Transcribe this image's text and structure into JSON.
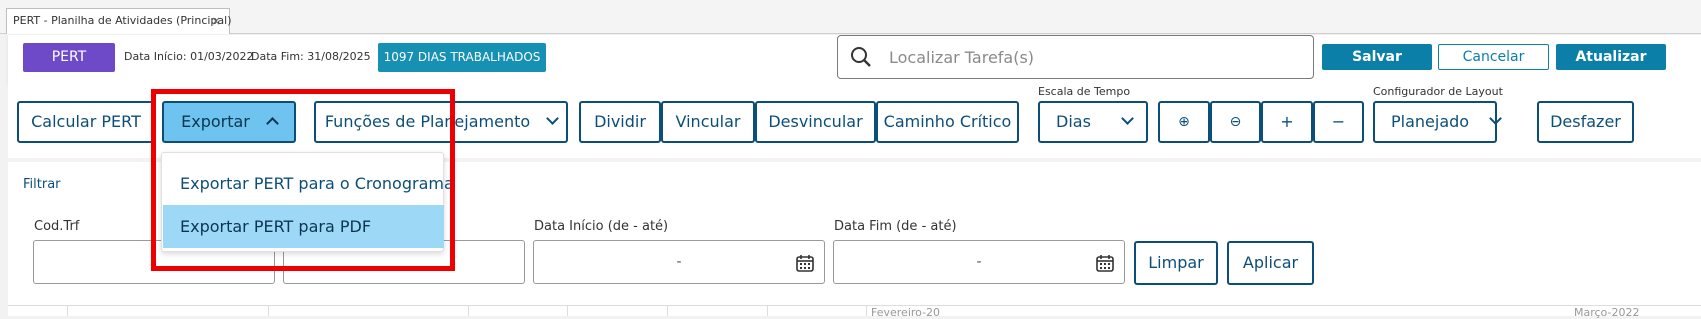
{
  "tab": {
    "title": "PERT - Planilha de Atividades (Principal)",
    "close": "×"
  },
  "header": {
    "badge": "PERT",
    "data_inicio_label": "Data Início: 01/03/2022",
    "data_fim_label": "Data Fim: 31/08/2025",
    "dias_badge": "1097 DIAS TRABALHADOS",
    "search_placeholder": "Localizar Tarefa(s)",
    "save": "Salvar",
    "cancel": "Cancelar",
    "update": "Atualizar"
  },
  "toolbar": {
    "calcular": "Calcular PERT",
    "exportar": "Exportar",
    "funcoes": "Funções de Planejamento",
    "dividir": "Dividir",
    "vincular": "Vincular",
    "desvincular": "Desvincular",
    "caminho": "Caminho Crítico",
    "escala_label": "Escala de Tempo",
    "escala_value": "Dias",
    "zoom_in": "⊕",
    "zoom_out": "⊖",
    "plus": "+",
    "minus": "−",
    "config_label": "Configurador de Layout",
    "config_value": "Planejado",
    "desfazer": "Desfazer"
  },
  "export_menu": {
    "items": [
      "Exportar PERT para o Cronograma",
      "Exportar PERT para PDF"
    ],
    "selected_index": 1
  },
  "filter": {
    "title": "Filtrar",
    "cod_label": "Cod.Trf",
    "data_inicio_label": "Data Início (de - até)",
    "data_fim_label": "Data Fim (de - até)",
    "range_placeholder": "-",
    "limpar": "Limpar",
    "aplicar": "Aplicar"
  },
  "timeline": {
    "month1": "Fevereiro-20",
    "month2": "Março-2022"
  },
  "colors": {
    "pert_badge": "#6e4ac8",
    "dias_badge": "#1690b3",
    "primary": "#0c7fa8",
    "outline": "#0c4e7a",
    "selected_item": "#9dd8f7",
    "highlight": "#ee0000"
  }
}
